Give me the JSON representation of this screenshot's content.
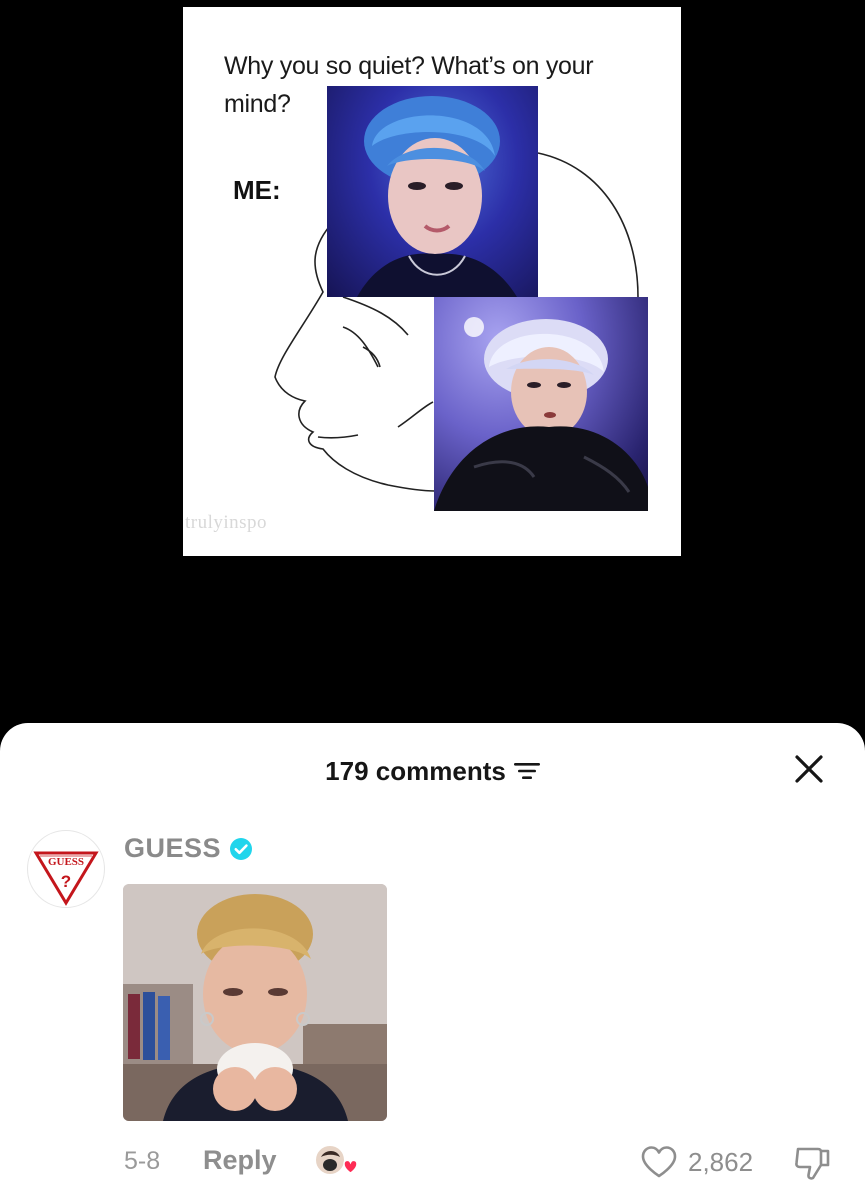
{
  "video": {
    "meme_caption": "Why you so quiet? What’s on your mind?",
    "meme_me_label": "ME:",
    "watermark": "trulyinspo"
  },
  "comments_sheet": {
    "count_label": "179 comments",
    "sort_icon": "sort-lines-icon",
    "close_icon": "close-icon"
  },
  "comment": {
    "username": "GUESS",
    "verified_icon": "verified-check-icon",
    "avatar_logo_text": "GUESS",
    "avatar_logo_mark": "?",
    "date": "5-8",
    "reply_label": "Reply",
    "like_count": "2,862",
    "like_icon": "heart-outline-icon",
    "dislike_icon": "thumbs-down-icon",
    "creator_liked_icon": "creator-liked-heart-icon"
  },
  "colors": {
    "background": "#000000",
    "sheet": "#ffffff",
    "verified": "#20d5ec",
    "muted_text": "#8e8e8e",
    "creator_heart": "#fe2c55"
  }
}
